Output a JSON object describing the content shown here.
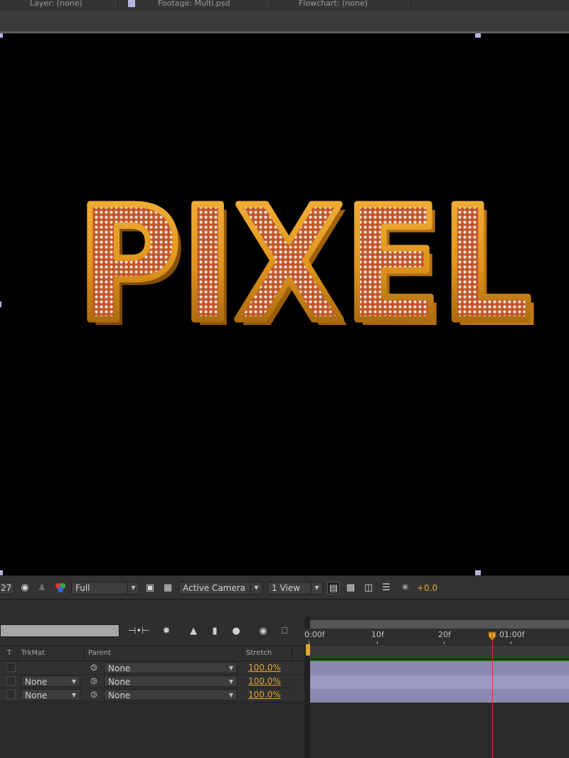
{
  "top_tabs": {
    "layer": "Layer: (none)",
    "footage": "Footage: Multi.psd",
    "flowchart": "Flowchart: (none)"
  },
  "viewer": {
    "text_3d": "PIXEL"
  },
  "viewer_toolbar": {
    "magnification": "27",
    "resolution": "Full",
    "camera": "Active Camera",
    "view_layout": "1 View",
    "exposure": "+0.0"
  },
  "timeline": {
    "columns": {
      "t": "T",
      "trkmat": "TrkMat",
      "parent": "Parent",
      "stretch": "Stretch"
    },
    "ruler": {
      "labels": [
        "0:00f",
        "10f",
        "20f",
        "01:00f"
      ]
    },
    "layers": [
      {
        "trkmat": "",
        "parent": "None",
        "stretch": "100.0%"
      },
      {
        "trkmat": "None",
        "parent": "None",
        "stretch": "100.0%"
      },
      {
        "trkmat": "None",
        "parent": "None",
        "stretch": "100.0%"
      }
    ]
  },
  "colors": {
    "accent_orange": "#e3a42f",
    "cti_red": "#d83a2a",
    "layer_bar": "#8a8ab0",
    "layer_bar_selected": "#9a9ac2",
    "green_line": "#28c028"
  }
}
